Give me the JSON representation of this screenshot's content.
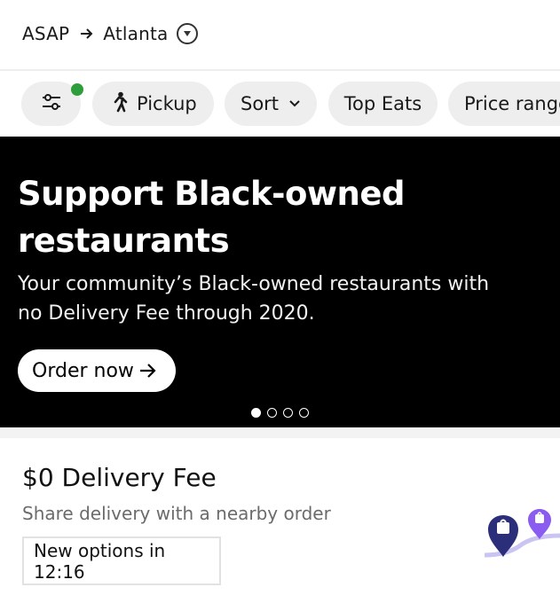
{
  "header": {
    "time_label": "ASAP",
    "location": "Atlanta",
    "arrow_icon": "arrow-right-icon",
    "dropdown_icon": "chevron-down-circle-icon"
  },
  "filters": {
    "filter_icon": "sliders-icon",
    "active_indicator_color": "#2e9e3c",
    "pickup_label": "Pickup",
    "pickup_icon": "walking-person-icon",
    "sort_label": "Sort",
    "top_eats_label": "Top Eats",
    "price_range_label": "Price range"
  },
  "banner": {
    "title": "Support Black-owned restaurants",
    "subtitle": "Your community’s Black-owned restaurants with no Delivery Fee through 2020.",
    "cta_label": "Order now",
    "carousel_total": 4,
    "carousel_active": 1
  },
  "promo": {
    "title": "$0 Delivery Fee",
    "subtitle": "Share delivery with a nearby order",
    "timer_label": "New options in 12:16",
    "illustration_icon": "delivery-route-pins-icon"
  },
  "colors": {
    "banner_bg": "#000000",
    "chip_bg": "#eeeeee",
    "pin_dark": "#2b2f7a",
    "pin_purple": "#8a5cf0"
  }
}
